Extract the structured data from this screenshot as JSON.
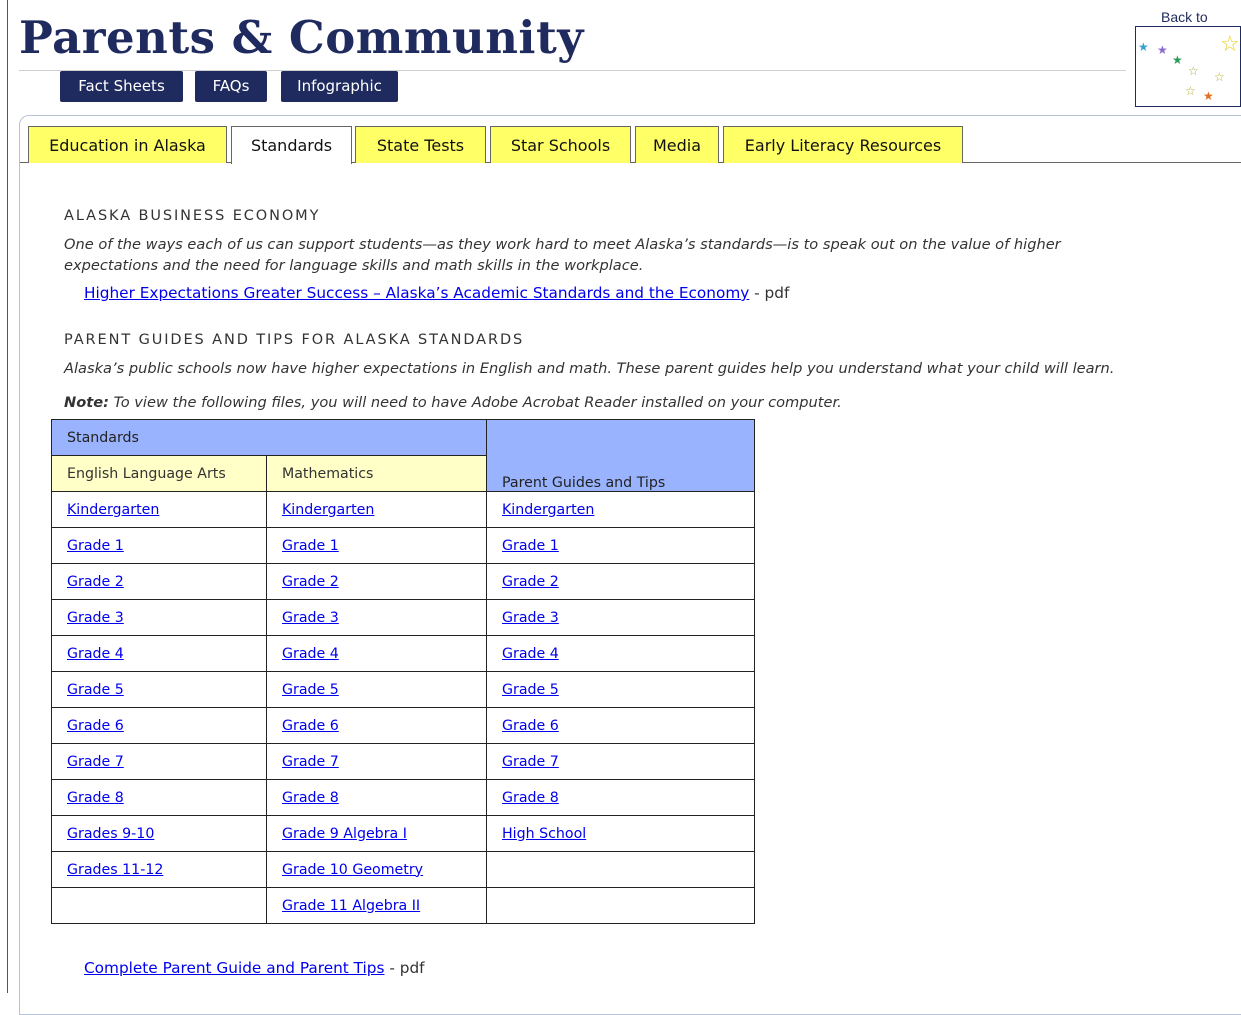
{
  "header": {
    "title": "Parents & Community",
    "subnav": [
      "Fact Sheets",
      "FAQs",
      "Infographic"
    ],
    "back_to": "Back to"
  },
  "tabs": [
    {
      "label": "Education in Alaska",
      "active": false
    },
    {
      "label": "Standards",
      "active": true
    },
    {
      "label": "State Tests",
      "active": false
    },
    {
      "label": "Star Schools",
      "active": false
    },
    {
      "label": "Media",
      "active": false
    },
    {
      "label": "Early Literacy Resources",
      "active": false
    }
  ],
  "economy": {
    "heading": "ALASKA BUSINESS ECONOMY",
    "intro_line1": "One of the ways each of us can support students—as they work hard to meet Alaska’s standards—is to speak out on the value of higher",
    "intro_line2": "expectations and the need for language skills and math skills in the workplace.",
    "link": "Higher Expectations Greater Success – Alaska’s Academic Standards and the Economy",
    "link_suffix": " - pdf"
  },
  "guides": {
    "heading": "PARENT GUIDES AND TIPS FOR ALASKA STANDARDS",
    "intro": "Alaska’s public schools now have higher expectations in English and math. These parent guides help you understand what your child will learn.",
    "note_label": "Note:",
    "note_text": " To view the following files, you will need to have Adobe Acrobat Reader installed on your computer."
  },
  "table": {
    "standards_header": "Standards",
    "guides_header": "Parent Guides and Tips",
    "ela_header": "English Language Arts",
    "math_header": "Mathematics",
    "rows": [
      [
        "Kindergarten",
        "Kindergarten",
        "Kindergarten"
      ],
      [
        "Grade 1",
        "Grade 1",
        "Grade 1"
      ],
      [
        "Grade 2",
        "Grade 2",
        "Grade 2"
      ],
      [
        "Grade 3",
        "Grade 3",
        "Grade 3"
      ],
      [
        "Grade 4",
        "Grade 4",
        "Grade 4"
      ],
      [
        "Grade 5",
        "Grade 5",
        "Grade 5"
      ],
      [
        "Grade 6",
        "Grade 6",
        "Grade 6"
      ],
      [
        "Grade 7",
        "Grade 7",
        "Grade 7"
      ],
      [
        "Grade 8",
        "Grade 8",
        "Grade 8"
      ],
      [
        "Grades 9-10",
        "Grade 9 Algebra I",
        "High School"
      ],
      [
        "Grades 11-12",
        "Grade 10 Geometry",
        ""
      ],
      [
        "",
        "Grade 11 Algebra II",
        ""
      ]
    ]
  },
  "footer_link": {
    "label": "Complete Parent Guide and Parent Tips",
    "suffix": " - pdf"
  },
  "colors": {
    "navy": "#1f2a5e",
    "tab_yellow": "#ffff66",
    "table_blue": "#99b3ff",
    "table_cream": "#ffffc7",
    "link": "#0000ee"
  }
}
